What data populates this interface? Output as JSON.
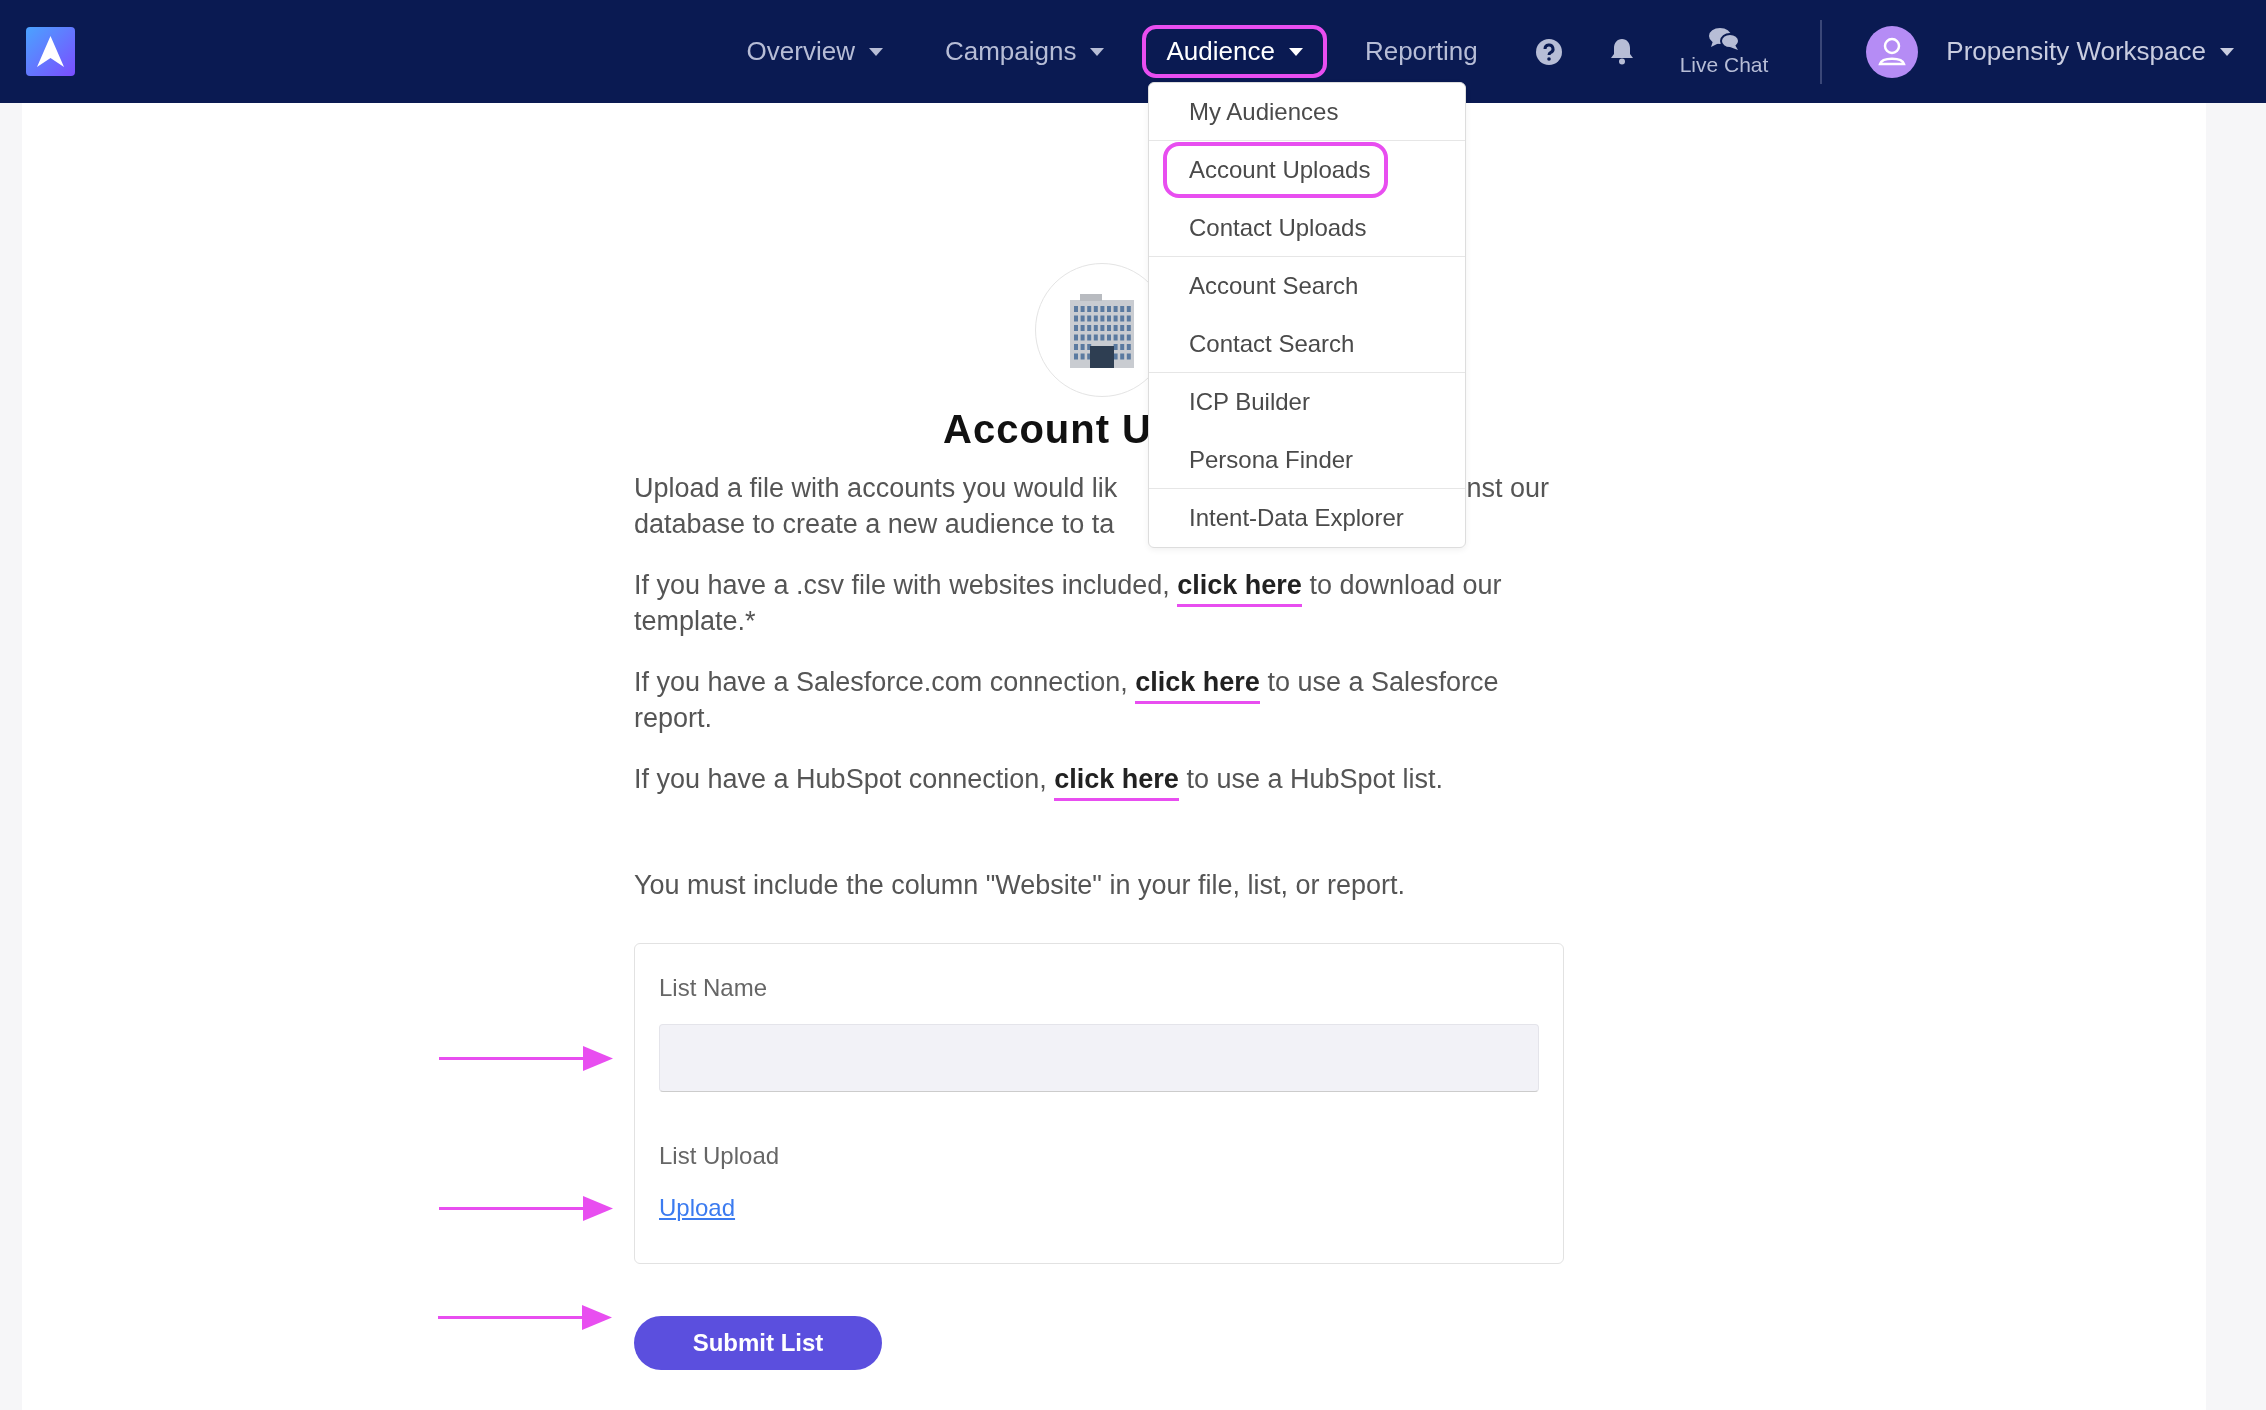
{
  "nav": {
    "items": [
      {
        "label": "Overview",
        "caret": true,
        "selected": false,
        "annotated": false
      },
      {
        "label": "Campaigns",
        "caret": true,
        "selected": false,
        "annotated": false
      },
      {
        "label": "Audience",
        "caret": true,
        "selected": true,
        "annotated": true
      },
      {
        "label": "Reporting",
        "caret": false,
        "selected": false,
        "annotated": false
      }
    ],
    "live_chat": "Live Chat",
    "workspace": "Propensity Workspace"
  },
  "menu": {
    "items": [
      {
        "label": "My Audiences",
        "divider_after": true,
        "annotated": false
      },
      {
        "label": "Account Uploads",
        "divider_after": false,
        "annotated": true
      },
      {
        "label": "Contact Uploads",
        "divider_after": true,
        "annotated": false
      },
      {
        "label": "Account Search",
        "divider_after": false,
        "annotated": false
      },
      {
        "label": "Contact Search",
        "divider_after": true,
        "annotated": false
      },
      {
        "label": "ICP Builder",
        "divider_after": false,
        "annotated": false
      },
      {
        "label": "Persona Finder",
        "divider_after": true,
        "annotated": false
      },
      {
        "label": "Intent-Data Explorer",
        "divider_after": false,
        "annotated": false
      }
    ]
  },
  "page": {
    "heading": "Account U",
    "intro": [
      "Upload a file with accounts you would lik",
      "nst our",
      "database to create a new audience to ta"
    ],
    "paragraphs": [
      {
        "before": "If you have a .csv file with websites included, ",
        "link": "click here",
        "after": " to download our template.*",
        "annotated": true
      },
      {
        "before": "If you have a Salesforce.com connection, ",
        "link": "click here",
        "after": " to use a Salesforce report.",
        "annotated": true
      },
      {
        "before": "If you have a HubSpot connection, ",
        "link": "click here",
        "after": " to use a HubSpot list.",
        "annotated": true
      }
    ],
    "note": "You must include the column \"Website\" in your file, list, or report.",
    "form": {
      "list_name_label": "List Name",
      "list_name_annotated": true,
      "list_upload_label": "List Upload",
      "upload_link": "Upload",
      "upload_annotated": true,
      "submit": "Submit List",
      "submit_annotated": true
    }
  }
}
